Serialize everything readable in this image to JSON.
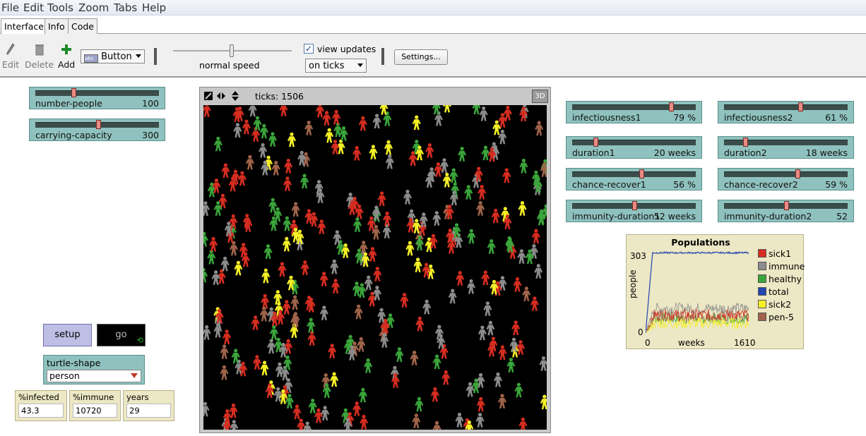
{
  "menu": [
    "File",
    "Edit",
    "Tools",
    "Zoom",
    "Tabs",
    "Help"
  ],
  "tabs": [
    "Interface",
    "Info",
    "Code"
  ],
  "toolbar": {
    "edit_label": "Edit",
    "delete_label": "Delete",
    "add_label": "Add",
    "widget_type": "Button",
    "speed_label": "normal speed",
    "view_updates_label": "view updates",
    "update_mode": "on ticks",
    "settings_label": "Settings..."
  },
  "sliders_left": [
    {
      "name": "number-people",
      "value": "100",
      "fraction": 0.37
    },
    {
      "name": "carrying-capacity",
      "value": "300",
      "fraction": 0.5
    }
  ],
  "sliders_right": [
    {
      "name": "infectiousness1",
      "value": "79 %",
      "fraction": 0.79
    },
    {
      "name": "infectiousness2",
      "value": "61 %",
      "fraction": 0.61
    },
    {
      "name": "duration1",
      "value": "20 weeks",
      "fraction": 0.18
    },
    {
      "name": "duration2",
      "value": "18 weeks",
      "fraction": 0.16
    },
    {
      "name": "chance-recover1",
      "value": "56 %",
      "fraction": 0.56
    },
    {
      "name": "chance-recover2",
      "value": "59 %",
      "fraction": 0.59
    },
    {
      "name": "immunity-duration1",
      "value": "52 weeks",
      "fraction": 0.51
    },
    {
      "name": "immunity-duration2",
      "value": "52",
      "fraction": 0.51
    }
  ],
  "buttons": {
    "setup": "setup",
    "go": "go",
    "forever_icon": "forever-arrows-icon"
  },
  "chooser": {
    "name": "turtle-shape",
    "value": "person"
  },
  "monitors": [
    {
      "name": "%infected",
      "value": "43.3"
    },
    {
      "name": "%immune",
      "value": "10720"
    },
    {
      "name": "years",
      "value": "29"
    }
  ],
  "view": {
    "ticks_label": "ticks: 1506",
    "btn_3d": "3D"
  },
  "plot": {
    "title": "Populations",
    "ylabel": "people",
    "xlabel": "weeks",
    "ymax_label": "303",
    "ymin_label": "0",
    "xmin_label": "0",
    "xmax_label": "1610",
    "legend": [
      {
        "name": "sick1",
        "color": "#d62d20"
      },
      {
        "name": "immune",
        "color": "#8c8c8c"
      },
      {
        "name": "healthy",
        "color": "#3aa53a"
      },
      {
        "name": "total",
        "color": "#2346b3"
      },
      {
        "name": "sick2",
        "color": "#f5f026"
      },
      {
        "name": "pen-5",
        "color": "#a0644a"
      }
    ]
  },
  "colors": {
    "widget_teal": "#8fc2be",
    "monitor_tan": "#ece7c4",
    "setup_lavender": "#bfbfe6",
    "sick1": "#d62d20",
    "sick2": "#f5f026",
    "healthy": "#3aa53a",
    "immune": "#8c8c8c",
    "pen5": "#a0644a"
  }
}
